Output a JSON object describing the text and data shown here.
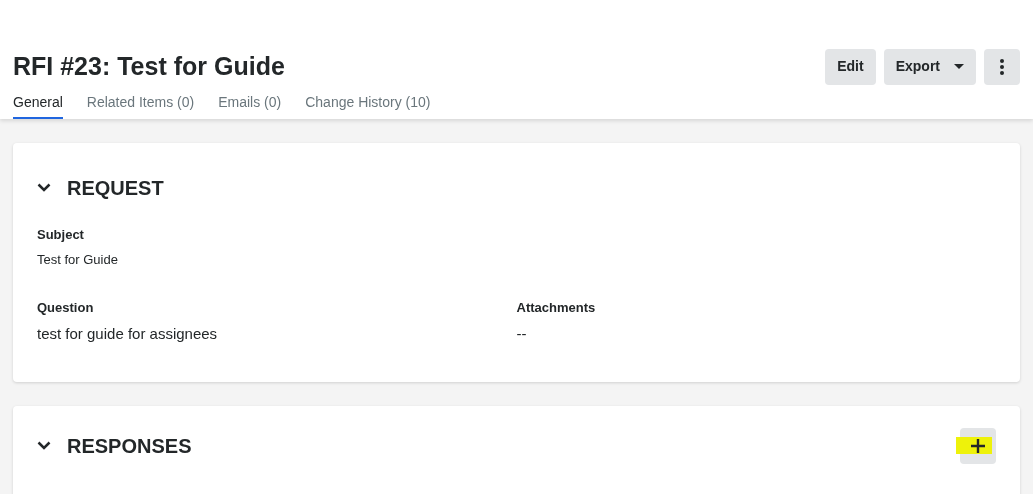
{
  "header": {
    "title": "RFI #23: Test for Guide",
    "actions": [
      {
        "kind": "button",
        "label": "Edit"
      },
      {
        "kind": "dropdown",
        "label": "Export"
      },
      {
        "kind": "more"
      }
    ]
  },
  "tabs": [
    {
      "label": "General",
      "selected": true
    },
    {
      "label": "Related Items (0)",
      "selected": false
    },
    {
      "label": "Emails (0)",
      "selected": false
    },
    {
      "label": "Change History (10)",
      "selected": false
    }
  ],
  "sections": [
    {
      "title": "REQUEST",
      "expanded": true,
      "add_button": false,
      "field_rows": [
        [
          {
            "label": "Subject",
            "value": "Test for Guide"
          }
        ],
        [
          {
            "label": "Question",
            "value": "test for guide for assignees"
          },
          {
            "label": "Attachments",
            "value": "--"
          }
        ]
      ]
    },
    {
      "title": "RESPONSES",
      "expanded": true,
      "add_button": true
    }
  ]
}
